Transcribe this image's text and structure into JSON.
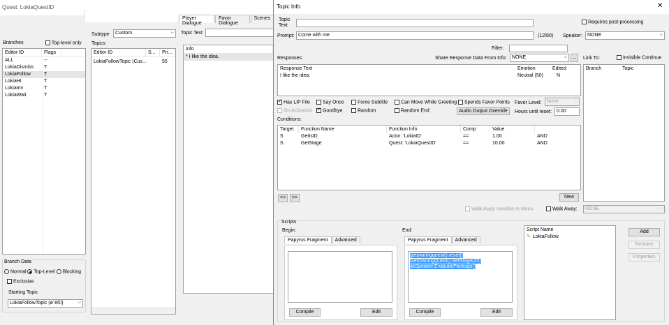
{
  "quest_window": {
    "title": "Quest: LokiaQuestID",
    "tabs": [
      "Player Dialogue",
      "Favor Dialogue",
      "Scenes"
    ],
    "branches_label": "Branches",
    "top_level_only_label": "Top-level only",
    "branch_columns": [
      "Editor ID",
      "Flags"
    ],
    "branches": [
      {
        "id": "ALL",
        "flags": "--"
      },
      {
        "id": "LokiaDismiss",
        "flags": "T"
      },
      {
        "id": "LokiaFollow",
        "flags": "T"
      },
      {
        "id": "LokiaHI",
        "flags": "T"
      },
      {
        "id": "LokiaInv",
        "flags": "T"
      },
      {
        "id": "LokiaWait",
        "flags": "T"
      }
    ],
    "subtype_label": "Subtype",
    "subtype_value": "Custom",
    "topics_label": "Topics",
    "topic_columns": [
      "Editor ID",
      "S...",
      "Pri..."
    ],
    "topics": [
      {
        "id": "LokiaFollowTopic (Cus...",
        "s": "",
        "pri": "55"
      }
    ],
    "topic_text_label": "Topic Text",
    "info_column": "Info",
    "info_rows": [
      "* I like the idea."
    ],
    "branch_data_label": "Branch Data",
    "radio_normal": "Normal",
    "radio_top_level": "Top-Level",
    "radio_blocking": "Blocking",
    "exclusive_label": "Exclusive",
    "starting_topic_label": "Starting Topic",
    "starting_topic_value": "LokiaFollowTopic (ø´ëßí)"
  },
  "topic_info": {
    "title": "Topic Info",
    "close_glyph": "✕",
    "topic_text_label": "Topic Text",
    "requires_post_processing": "Requires post-processing",
    "prompt_label": "Prompt:",
    "prompt_value": "Come with me",
    "prompt_count": "(12/80)",
    "speaker_label": "Speaker:",
    "speaker_value": "NONE",
    "filter_label": "Filter:",
    "responses_label": "Responses:",
    "share_label": "Share Response Data From Info:",
    "share_value": "NONE",
    "share_btn": "...",
    "link_to_label": "Link To:",
    "invisible_continue": "Invisible Continue",
    "response_columns": [
      "Response Text",
      "Emotion",
      "Edited"
    ],
    "responses": [
      {
        "text": "I like the idea.",
        "emotion": "Neutral (50)",
        "edited": "N"
      }
    ],
    "link_columns": [
      "Branch",
      "Topic"
    ],
    "flags": {
      "has_lip_file": "Has LIP File",
      "say_once": "Say Once",
      "force_subtitle": "Force Subtitle",
      "can_move": "Can Move While Greeting",
      "spends_favor": "Spends Favor Points",
      "favor_level_label": "Favor Level:",
      "favor_level_value": "None",
      "on_activation": "On Activation",
      "goodbye": "Goodbye",
      "random": "Random",
      "random_end": "Random End",
      "audio_output_override": "Audio Output Override",
      "hours_until_reset_label": "Hours until reset:",
      "hours_until_reset_value": "0.00"
    },
    "conditions_label": "Conditions:",
    "condition_columns": [
      "Target",
      "Function Name",
      "Function Info",
      "Comp",
      "Value",
      ""
    ],
    "conditions": [
      {
        "target": "S",
        "fn": "GetIsID",
        "info": "Actor: 'LokiaID'",
        "comp": "==",
        "value": "1.00",
        "op": "AND"
      },
      {
        "target": "S",
        "fn": "GetStage",
        "info": "Quest: 'LokiaQuestID'",
        "comp": "==",
        "value": "10.00",
        "op": "AND"
      }
    ],
    "new_btn": "New",
    "prev_btn": "<<",
    "next_btn": ">>",
    "walk_away_invisible": "Walk Away Invisible In Menu",
    "walk_away_label": "Walk Away:",
    "walk_away_value": "NONE",
    "scripts_label": "Scripts",
    "begin_label": "Begin:",
    "end_label": "End:",
    "papyrus_tab": "Papyrus Fragment",
    "advanced_tab": "Advanced",
    "end_script_lines": [
      "getowningquest().reset()",
      "GetOwningQuest().SetStage(20)",
      "akSpeaker.EvaluatePackage()"
    ],
    "compile_btn": "Compile",
    "edit_btn": "Edit",
    "script_name_col": "Script Name",
    "script_name": "LokiaFollow",
    "add_btn": "Add",
    "remove_btn": "Remove",
    "properties_btn": "Properties"
  }
}
